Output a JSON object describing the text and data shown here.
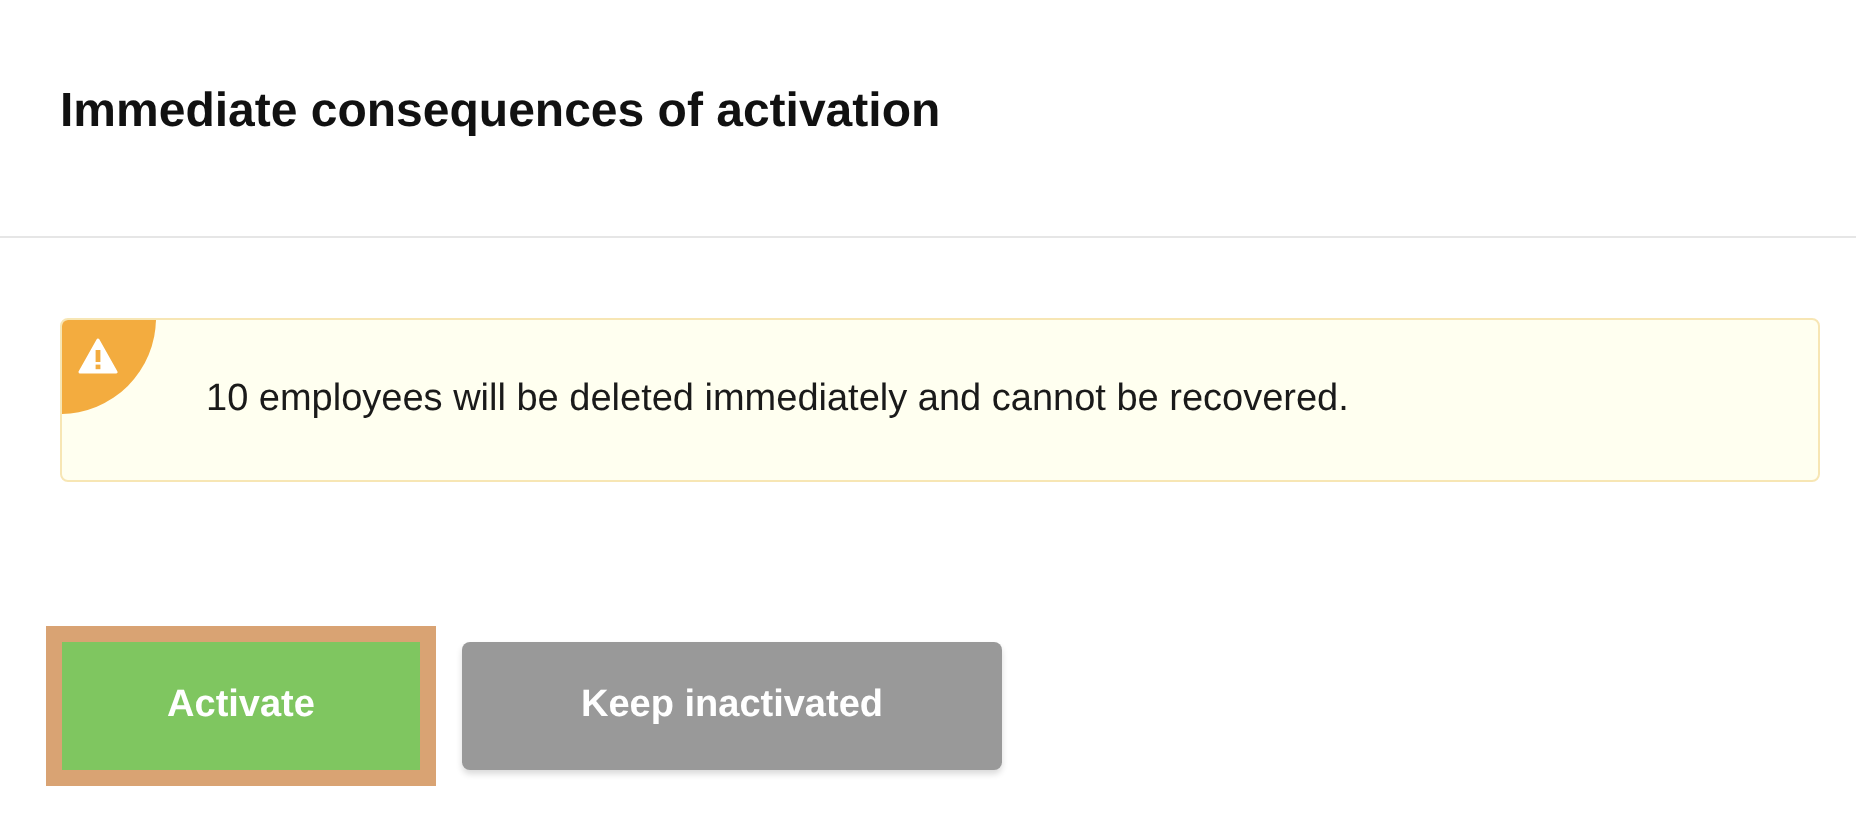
{
  "dialog": {
    "title": "Immediate consequences of activation"
  },
  "alert": {
    "kind": "warning",
    "message": "10 employees will be deleted immediately and cannot be recovered."
  },
  "buttons": [
    {
      "label": "Activate",
      "kind": "primary",
      "focused": true
    },
    {
      "label": "Keep inactivated",
      "kind": "secondary",
      "focused": false
    }
  ]
}
